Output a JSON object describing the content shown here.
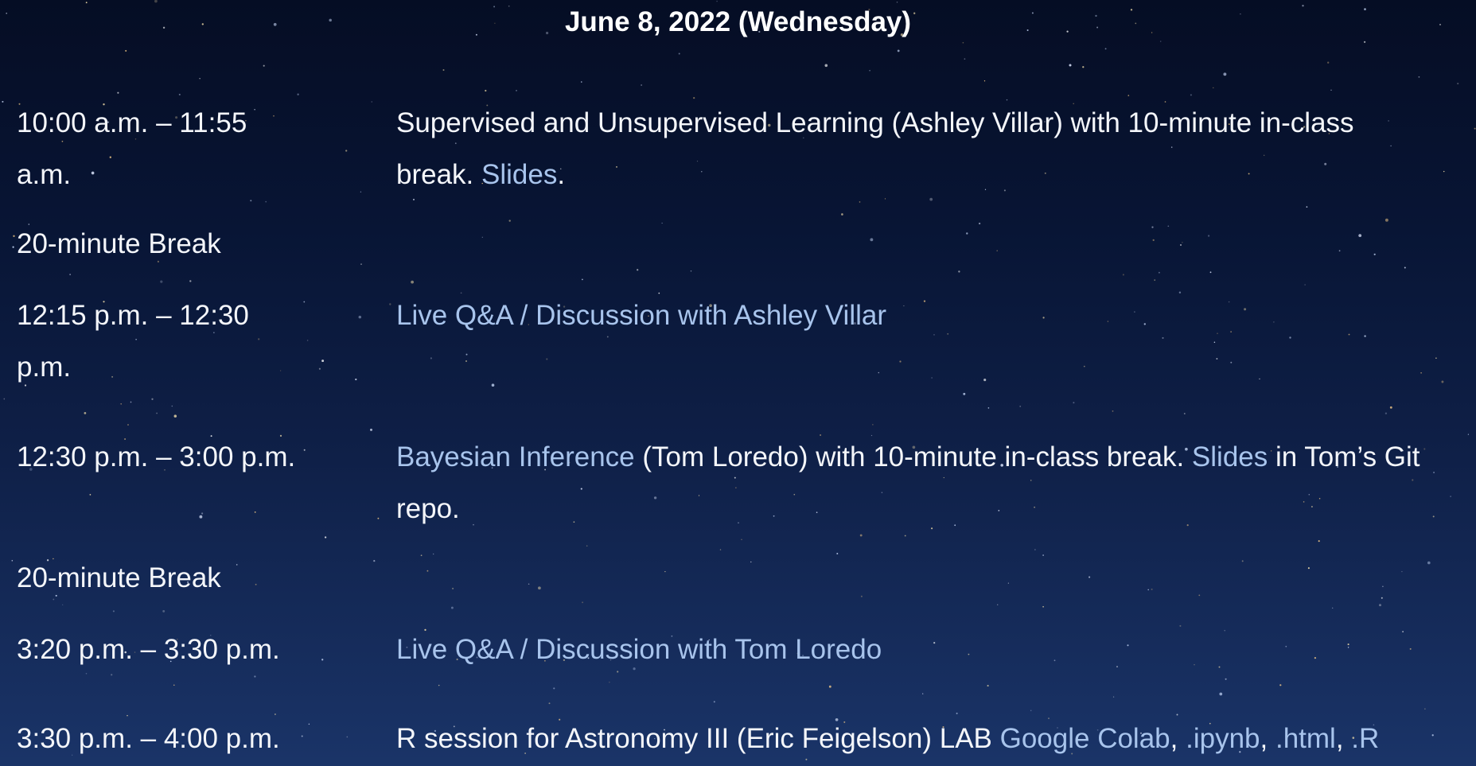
{
  "page": {
    "date_heading": "June 8, 2022 (Wednesday)"
  },
  "colors": {
    "text": "#f4f6fa",
    "link": "#a8c4ec",
    "background_top": "#050d24",
    "background_bottom": "#1a3468"
  },
  "schedule": {
    "row1": {
      "time_line1": "10:00 a.m. – 11:55",
      "time_line2": "a.m.",
      "desc_line1": "Supervised and Unsupervised Learning (Ashley Villar) with 10-minute in-class",
      "desc_line2_prefix": "break. ",
      "slides_link": "Slides",
      "desc_line2_suffix": "."
    },
    "break1": "20-minute Break",
    "row2": {
      "time_line1": "12:15 p.m. – 12:30",
      "time_line2": "p.m.",
      "link": "Live Q&A / Discussion with Ashley Villar"
    },
    "row3": {
      "time": "12:30 p.m. – 3:00 p.m.",
      "topic_link": "Bayesian Inference",
      "desc_middle": " (Tom Loredo) with 10-minute in-class break. ",
      "slides_link": "Slides",
      "desc_suffix": " in Tom’s Git",
      "desc_line2": "repo."
    },
    "break2": "20-minute Break",
    "row4": {
      "time": "3:20 p.m. – 3:30 p.m.",
      "link": "Live Q&A / Discussion with Tom Loredo"
    },
    "row5": {
      "time": "3:30 p.m. – 4:00 p.m.",
      "desc_prefix": "R session for Astronomy III (Eric Feigelson) LAB ",
      "link_colab": "Google Colab",
      "sep1": ", ",
      "link_ipynb": ".ipynb",
      "sep2": ", ",
      "link_html": ".html",
      "sep3": ", ",
      "link_r": ".R"
    }
  }
}
